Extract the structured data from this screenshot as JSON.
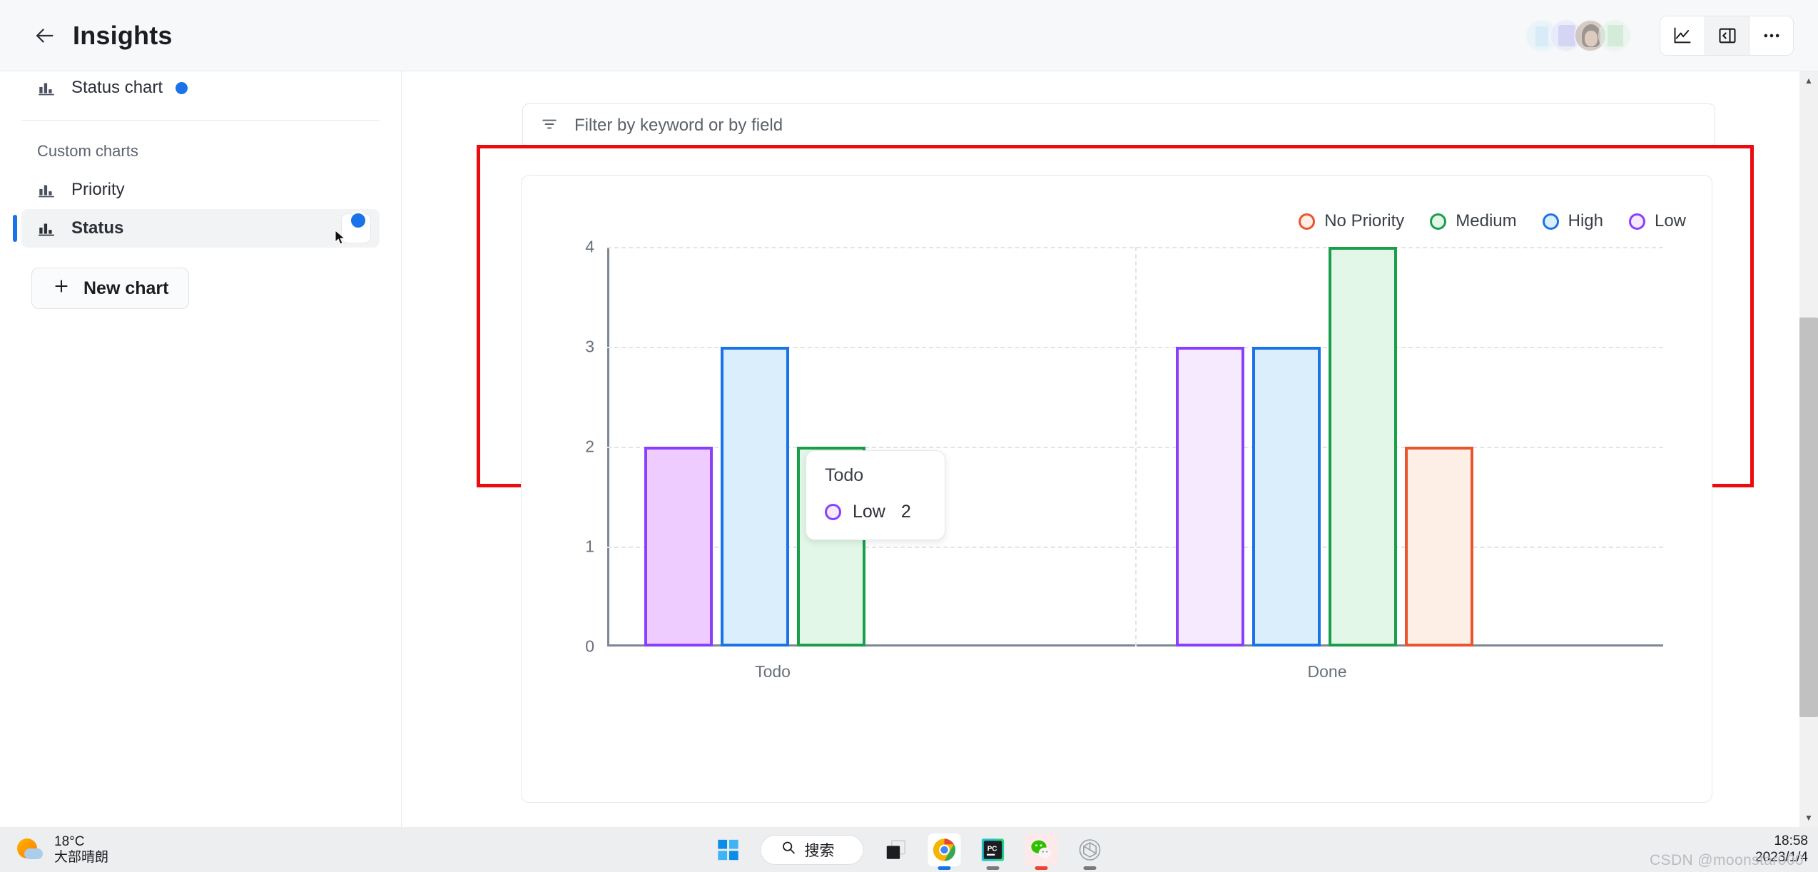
{
  "header": {
    "title": "Insights",
    "back_icon": "arrow-left-icon",
    "actions": [
      {
        "id": "chart-view",
        "icon": "line-chart-icon",
        "active": false
      },
      {
        "id": "panel-toggle",
        "icon": "sidebar-panel-icon",
        "active": true
      },
      {
        "id": "more",
        "icon": "ellipsis-icon",
        "active": false
      }
    ]
  },
  "sidebar": {
    "top_item": {
      "label": "Status chart",
      "icon": "bar-chart-icon",
      "has_dot": true
    },
    "section_label": "Custom charts",
    "items": [
      {
        "label": "Priority",
        "icon": "bar-chart-icon",
        "selected": false
      },
      {
        "label": "Status",
        "icon": "bar-chart-icon",
        "selected": true
      }
    ],
    "new_chart_label": "New chart",
    "new_chart_icon": "plus-icon"
  },
  "main": {
    "filter": {
      "icon": "filter-icon",
      "placeholder": "Filter by keyword or by field",
      "value": ""
    }
  },
  "tooltip": {
    "title": "Todo",
    "series_label": "Low",
    "value": "2",
    "color": "#8a3ffc"
  },
  "colors": {
    "no_priority": "#e8552f",
    "medium": "#1a9e4b",
    "high": "#1a73e8",
    "low": "#8a3ffc",
    "highlight_box": "#ec0c10",
    "accent": "#1a73e8"
  },
  "chart_data": {
    "type": "bar",
    "title": "",
    "xlabel": "",
    "ylabel": "",
    "categories": [
      "Todo",
      "Done"
    ],
    "ylim": [
      0,
      4
    ],
    "yticks": [
      "0",
      "1",
      "2",
      "3",
      "4"
    ],
    "grid": true,
    "legend_position": "top-right",
    "series": [
      {
        "name": "No Priority",
        "color": "#e8552f",
        "fill": "#fdeee6",
        "values": [
          0,
          2
        ]
      },
      {
        "name": "Medium",
        "color": "#1a9e4b",
        "fill": "#e2f7e8",
        "values": [
          2,
          4
        ]
      },
      {
        "name": "High",
        "color": "#1a73e8",
        "fill": "#dbeefc",
        "values": [
          3,
          3
        ]
      },
      {
        "name": "Low",
        "color": "#8a3ffc",
        "fill": "#f6eaff",
        "values": [
          2,
          3
        ]
      }
    ],
    "bar_order_todo": [
      "Low",
      "High",
      "Medium"
    ],
    "bar_order_done": [
      "Low",
      "High",
      "Medium",
      "No Priority"
    ],
    "hovered_bar": {
      "category": "Todo",
      "series": "Low",
      "value": 2
    }
  },
  "taskbar": {
    "weather": {
      "temp": "18°C",
      "desc": "大部晴朗",
      "icon": "sun-cloud-icon"
    },
    "search_label": "搜索",
    "search_icon": "search-icon",
    "apps": [
      {
        "id": "start",
        "icon": "windows-icon"
      },
      {
        "id": "task-view",
        "icon": "task-view-icon"
      },
      {
        "id": "chrome",
        "icon": "chrome-icon",
        "running": true
      },
      {
        "id": "pycharm",
        "icon": "pycharm-icon",
        "running": true
      },
      {
        "id": "wechat",
        "icon": "wechat-icon",
        "running": true
      },
      {
        "id": "chatgpt",
        "icon": "chatgpt-icon",
        "running": true
      }
    ],
    "clock": {
      "time": "18:58",
      "date": "2023/1/4"
    }
  },
  "watermark": "CSDN @moonstar000"
}
